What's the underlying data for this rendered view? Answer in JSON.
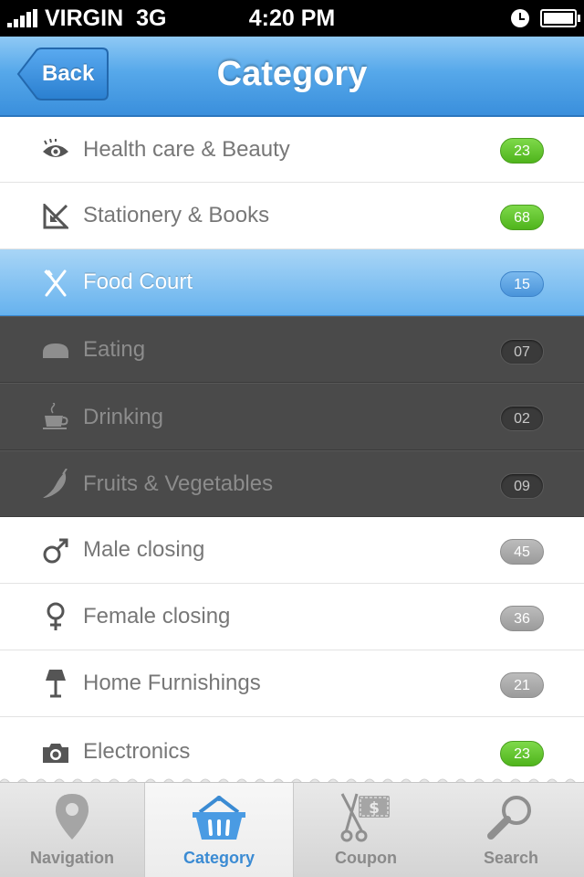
{
  "status_bar": {
    "carrier": "VIRGIN",
    "network": "3G",
    "time": "4:20 PM"
  },
  "nav": {
    "back_label": "Back",
    "title": "Category"
  },
  "categories": [
    {
      "label": "Health care & Beauty",
      "count": "23",
      "icon": "eye-icon",
      "badge_color": "#5cbf2a"
    },
    {
      "label": "Stationery & Books",
      "count": "68",
      "icon": "ruler-triangle-icon",
      "badge_color": "#5cbf2a"
    },
    {
      "label": "Food Court",
      "count": "15",
      "icon": "fork-knife-icon",
      "badge_color": "#4a94da",
      "selected": true
    },
    {
      "label": "Eating",
      "count": "07",
      "icon": "bread-icon",
      "sub": true
    },
    {
      "label": "Drinking",
      "count": "02",
      "icon": "coffee-cup-icon",
      "sub": true
    },
    {
      "label": "Fruits & Vegetables",
      "count": "09",
      "icon": "chili-pepper-icon",
      "sub": true
    },
    {
      "label": "Male closing",
      "count": "45",
      "icon": "male-symbol-icon",
      "badge_color": "#a8a8a8"
    },
    {
      "label": "Female closing",
      "count": "36",
      "icon": "female-symbol-icon",
      "badge_color": "#a8a8a8"
    },
    {
      "label": "Home Furnishings",
      "count": "21",
      "icon": "lamp-icon",
      "badge_color": "#a8a8a8"
    },
    {
      "label": "Electronics",
      "count": "23",
      "icon": "camera-icon",
      "badge_color": "#5cbf2a"
    }
  ],
  "tabs": [
    {
      "label": "Navigation",
      "icon": "map-pin-icon"
    },
    {
      "label": "Category",
      "icon": "basket-icon",
      "active": true
    },
    {
      "label": "Coupon",
      "icon": "coupon-scissors-icon"
    },
    {
      "label": "Search",
      "icon": "magnifier-icon"
    }
  ],
  "colors": {
    "nav_blue": "#4a9be3",
    "selected_row": "#7fbdf0",
    "subrow_dark": "#4a4a4a",
    "tab_active_text": "#3b8bd3"
  }
}
